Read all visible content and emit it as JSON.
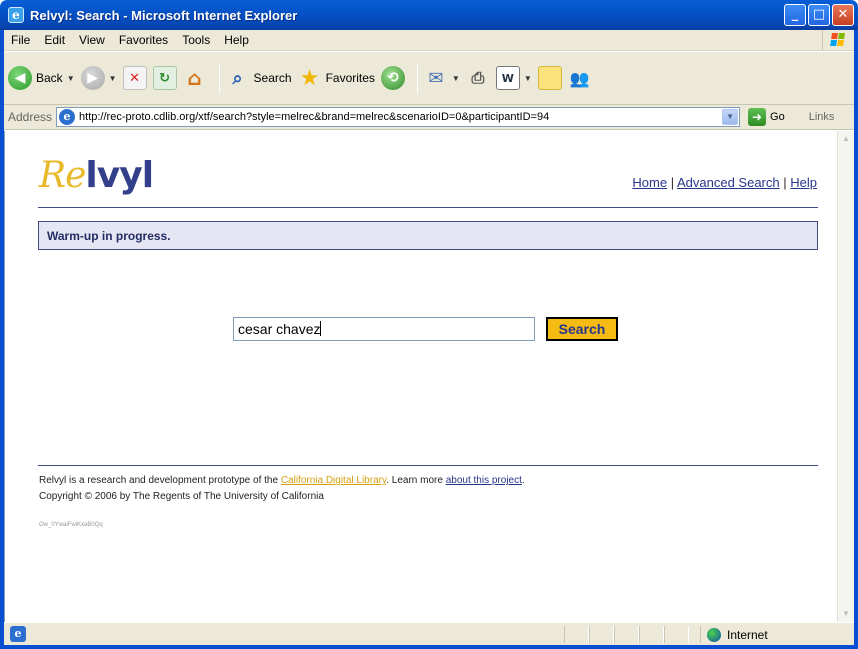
{
  "window": {
    "title": "Relvyl: Search - Microsoft Internet Explorer"
  },
  "menu": {
    "items": [
      "File",
      "Edit",
      "View",
      "Favorites",
      "Tools",
      "Help"
    ]
  },
  "toolbar": {
    "back_label": "Back",
    "search_label": "Search",
    "favorites_label": "Favorites"
  },
  "address": {
    "label": "Address",
    "url": "http://rec-proto.cdlib.org/xtf/search?style=melrec&brand=melrec&scenarioID=0&participantID=94",
    "go_label": "Go",
    "links_label": "Links"
  },
  "page": {
    "logo_prefix": "Re",
    "logo_suffix": "lvyl",
    "nav": {
      "home": "Home",
      "advanced": "Advanced Search",
      "help": "Help",
      "sep": "|"
    },
    "status_message": "Warm-up in progress.",
    "search": {
      "value": "cesar chavez",
      "button_label": "Search"
    },
    "footer": {
      "line1_prefix": "Relvyl is a research and development prototype of the ",
      "cdl_link": "California Digital Library",
      "line1_mid": ". Learn more ",
      "about_link": "about this project",
      "line1_suffix": ".",
      "copyright": "Copyright © 2006 by The Regents of The University of California"
    },
    "tiny_code": "Ow_0YwaiFwiKxaB0Qq"
  },
  "statusbar": {
    "zone": "Internet"
  },
  "colors": {
    "brand_navy": "#333f8a",
    "brand_gold": "#e8b92a",
    "button_gold": "#f5bb13",
    "status_bg": "#e5e5f3"
  }
}
